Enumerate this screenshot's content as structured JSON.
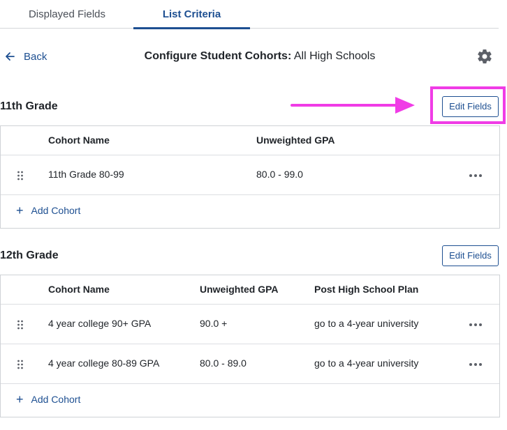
{
  "tabs": [
    {
      "label": "Displayed Fields",
      "active": false
    },
    {
      "label": "List Criteria",
      "active": true
    }
  ],
  "header": {
    "back_label": "Back",
    "title_bold": "Configure Student Cohorts:",
    "title_rest": "All High Schools"
  },
  "sections": [
    {
      "title": "11th Grade",
      "edit_label": "Edit Fields",
      "columns": [
        "Cohort Name",
        "Unweighted GPA"
      ],
      "rows": [
        [
          "11th Grade 80-99",
          "80.0 - 99.0"
        ]
      ],
      "add_label": "Add Cohort"
    },
    {
      "title": "12th Grade",
      "edit_label": "Edit Fields",
      "columns": [
        "Cohort Name",
        "Unweighted GPA",
        "Post High School Plan"
      ],
      "rows": [
        [
          "4 year college 90+ GPA",
          "90.0 +",
          "go to a 4-year university"
        ],
        [
          "4 year college 80-89 GPA",
          "80.0 - 89.0",
          "go to a 4-year university"
        ]
      ],
      "add_label": "Add Cohort"
    }
  ],
  "icons": {
    "back": "arrow-left-icon",
    "settings": "gear-icon",
    "drag": "drag-handle-icon",
    "more": "more-horizontal-icon",
    "add": "plus-icon"
  },
  "colors": {
    "accent": "#1d4f91",
    "annotation": "#f03ce6",
    "border": "#cfd2d6"
  }
}
